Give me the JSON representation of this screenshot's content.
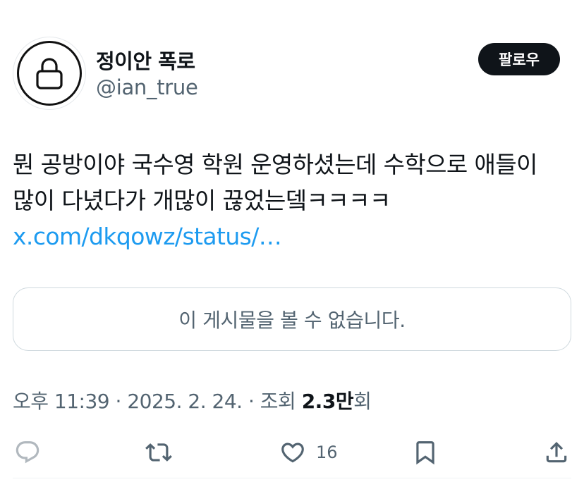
{
  "author": {
    "display_name": "정이안 폭로",
    "handle": "@ian_true",
    "avatar_icon": "lock-icon"
  },
  "follow_label": "팔로우",
  "tweet": {
    "text": "뭔 공방이야 국수영 학원 운영하셨는데 수학으로 애들이 많이 다녔다가 개많이 끊었는뎈ㅋㅋㅋㅋ ",
    "link_text": "x.com/dkqowz/status/…"
  },
  "embed": {
    "unavailable_text": "이 게시물을 볼 수 없습니다."
  },
  "meta": {
    "time": "오후 11:39",
    "date": "2025. 2. 24.",
    "views_prefix": "조회",
    "views_number": "2.3",
    "views_unit": "만",
    "views_suffix": "회"
  },
  "actions": {
    "reply_icon": "reply-icon",
    "retweet_icon": "retweet-icon",
    "like_icon": "heart-icon",
    "like_count": "16",
    "bookmark_icon": "bookmark-icon",
    "share_icon": "share-icon"
  }
}
